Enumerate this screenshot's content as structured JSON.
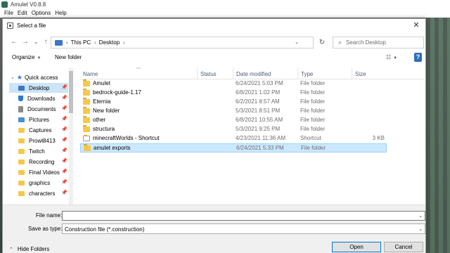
{
  "app": {
    "title": "Amulet V0.8.8",
    "menu": [
      "File",
      "Edit",
      "Options",
      "Help"
    ]
  },
  "dialog": {
    "title": "Select a file",
    "close": "✕"
  },
  "nav": {
    "back": "←",
    "forward": "→",
    "recent": "⌄",
    "up": "↑",
    "breadcrumb": [
      "This PC",
      "Desktop"
    ],
    "refresh": "↻",
    "search_placeholder": "Search Desktop"
  },
  "toolbar": {
    "organize": "Organize",
    "new_folder": "New folder",
    "help": "?"
  },
  "nav_pane": {
    "items": [
      {
        "label": "Quick access",
        "icon": "star-icon",
        "color": "#2b79d0",
        "pinned": false
      },
      {
        "label": "Desktop",
        "icon": "desktop-icon",
        "color": "#3a78c7",
        "pinned": true,
        "selected": true
      },
      {
        "label": "Downloads",
        "icon": "download-icon",
        "color": "#2b79d0",
        "pinned": true
      },
      {
        "label": "Documents",
        "icon": "documents-icon",
        "color": "#8a8a8a",
        "pinned": true
      },
      {
        "label": "Pictures",
        "icon": "pictures-icon",
        "color": "#4a90c8",
        "pinned": true
      },
      {
        "label": "Captures",
        "icon": "folder-icon",
        "color": "#f5c84b",
        "pinned": true
      },
      {
        "label": "Prowl8413",
        "icon": "folder-icon",
        "color": "#f5c84b",
        "pinned": true
      },
      {
        "label": "Twitch",
        "icon": "folder-icon",
        "color": "#f5c84b",
        "pinned": true
      },
      {
        "label": "Recording",
        "icon": "folder-icon",
        "color": "#f5c84b",
        "pinned": true
      },
      {
        "label": "Final Videos",
        "icon": "folder-icon",
        "color": "#f5c84b",
        "pinned": true
      },
      {
        "label": "graphics",
        "icon": "folder-icon",
        "color": "#f5c84b",
        "pinned": true
      },
      {
        "label": "characters",
        "icon": "folder-icon",
        "color": "#f5c84b",
        "pinned": true
      }
    ]
  },
  "columns": {
    "name": "Name",
    "status": "Status",
    "date": "Date modified",
    "type": "Type",
    "size": "Size"
  },
  "files": [
    {
      "name": "Amulet",
      "date": "6/24/2021 5:03 PM",
      "type": "File folder",
      "size": ""
    },
    {
      "name": "bedrock-guide-1.17",
      "date": "6/8/2021 1:02 PM",
      "type": "File folder",
      "size": ""
    },
    {
      "name": "Eternia",
      "date": "6/2/2021 8:57 AM",
      "type": "File folder",
      "size": ""
    },
    {
      "name": "New folder",
      "date": "5/3/2021 8:51 PM",
      "type": "File folder",
      "size": ""
    },
    {
      "name": "other",
      "date": "6/8/2021 10:55 AM",
      "type": "File folder",
      "size": ""
    },
    {
      "name": "structura",
      "date": "5/3/2021 9:25 PM",
      "type": "File folder",
      "size": ""
    },
    {
      "name": "minecraftWorlds - Shortcut",
      "date": "4/23/2021 11:36 AM",
      "type": "Shortcut",
      "size": "3 KB"
    },
    {
      "name": "amulet exports",
      "date": "6/24/2021 5:33 PM",
      "type": "File folder",
      "size": ""
    }
  ],
  "bottom": {
    "file_name_label": "File name:",
    "file_name_value": "",
    "save_as_label": "Save as type:",
    "save_as_value": "Construction file (*.construction)",
    "hide_folders": "Hide Folders",
    "open": "Open",
    "cancel": "Cancel"
  }
}
